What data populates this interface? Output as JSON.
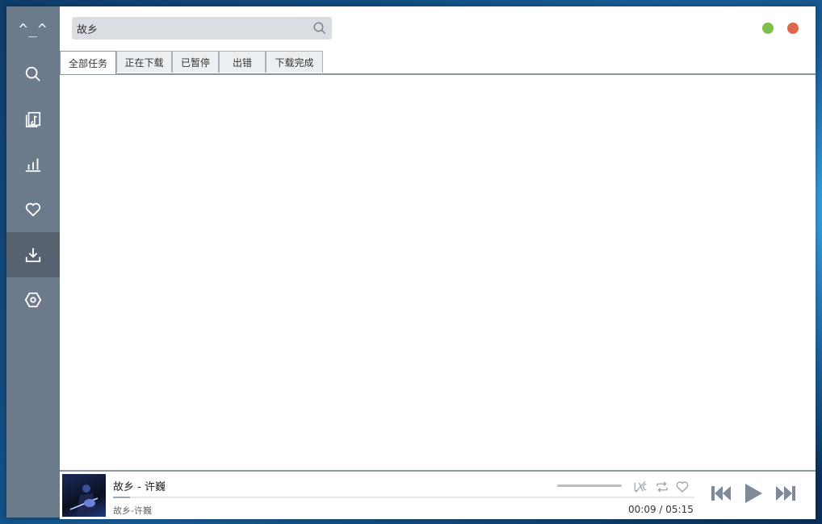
{
  "app": {
    "logo_text": "^_^",
    "accent_color": "#6b7b8c",
    "active_nav": "download"
  },
  "sidebar": {
    "items": [
      {
        "id": "search",
        "icon": "search-icon"
      },
      {
        "id": "library",
        "icon": "music-library-icon"
      },
      {
        "id": "charts",
        "icon": "chart-icon"
      },
      {
        "id": "favorites",
        "icon": "heart-icon"
      },
      {
        "id": "download",
        "icon": "download-icon"
      },
      {
        "id": "settings",
        "icon": "hexagon-settings-icon"
      }
    ]
  },
  "search": {
    "value": "故乡",
    "icon": "search-icon"
  },
  "window_controls": {
    "minimize_color": "#7dbf4a",
    "close_color": "#e0664e"
  },
  "tabs": [
    {
      "label": "全部任务",
      "active": true
    },
    {
      "label": "正在下载",
      "active": false
    },
    {
      "label": "已暂停",
      "active": false
    },
    {
      "label": "出错",
      "active": false
    },
    {
      "label": "下载完成",
      "active": false
    }
  ],
  "player": {
    "title": "故乡 - 许巍",
    "subtitle": "故乡-许巍",
    "current_time": "00:09",
    "total_time": "05:15",
    "time_separator": "/",
    "progress": 0.029,
    "icons": [
      "lyrics-icon",
      "repeat-icon",
      "favorite-icon",
      "previous-icon",
      "play-icon",
      "next-icon"
    ]
  }
}
